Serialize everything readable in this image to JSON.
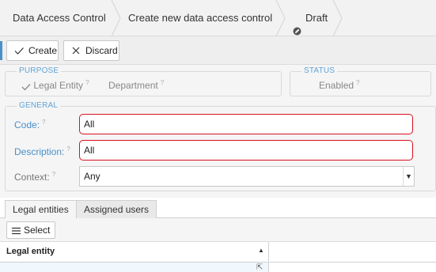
{
  "breadcrumb": {
    "items": [
      "Data Access Control",
      "Create new data access control"
    ],
    "status_label": "Draft"
  },
  "toolbar": {
    "create_label": "Create",
    "discard_label": "Discard"
  },
  "purpose": {
    "title": "PURPOSE",
    "options": [
      {
        "label": "Legal Entity",
        "checked": true
      },
      {
        "label": "Department",
        "checked": false
      }
    ]
  },
  "status": {
    "title": "STATUS",
    "value": "Enabled"
  },
  "general": {
    "title": "GENERAL",
    "code_label": "Code:",
    "code_value": "All",
    "description_label": "Description:",
    "description_value": "All",
    "context_label": "Context:",
    "context_value": "Any"
  },
  "tabs": [
    {
      "label": "Legal entities",
      "active": true
    },
    {
      "label": "Assigned users",
      "active": false
    }
  ],
  "subtoolbar": {
    "select_label": "Select"
  },
  "grid": {
    "columns": [
      "Legal entity"
    ]
  },
  "colors": {
    "accent": "#4a8fc8",
    "error_border": "#d9101e",
    "group_title": "#5fa3d6"
  },
  "icons": {
    "help": "?",
    "sort": "▲",
    "dropdown": "▼",
    "open": "⇱"
  }
}
